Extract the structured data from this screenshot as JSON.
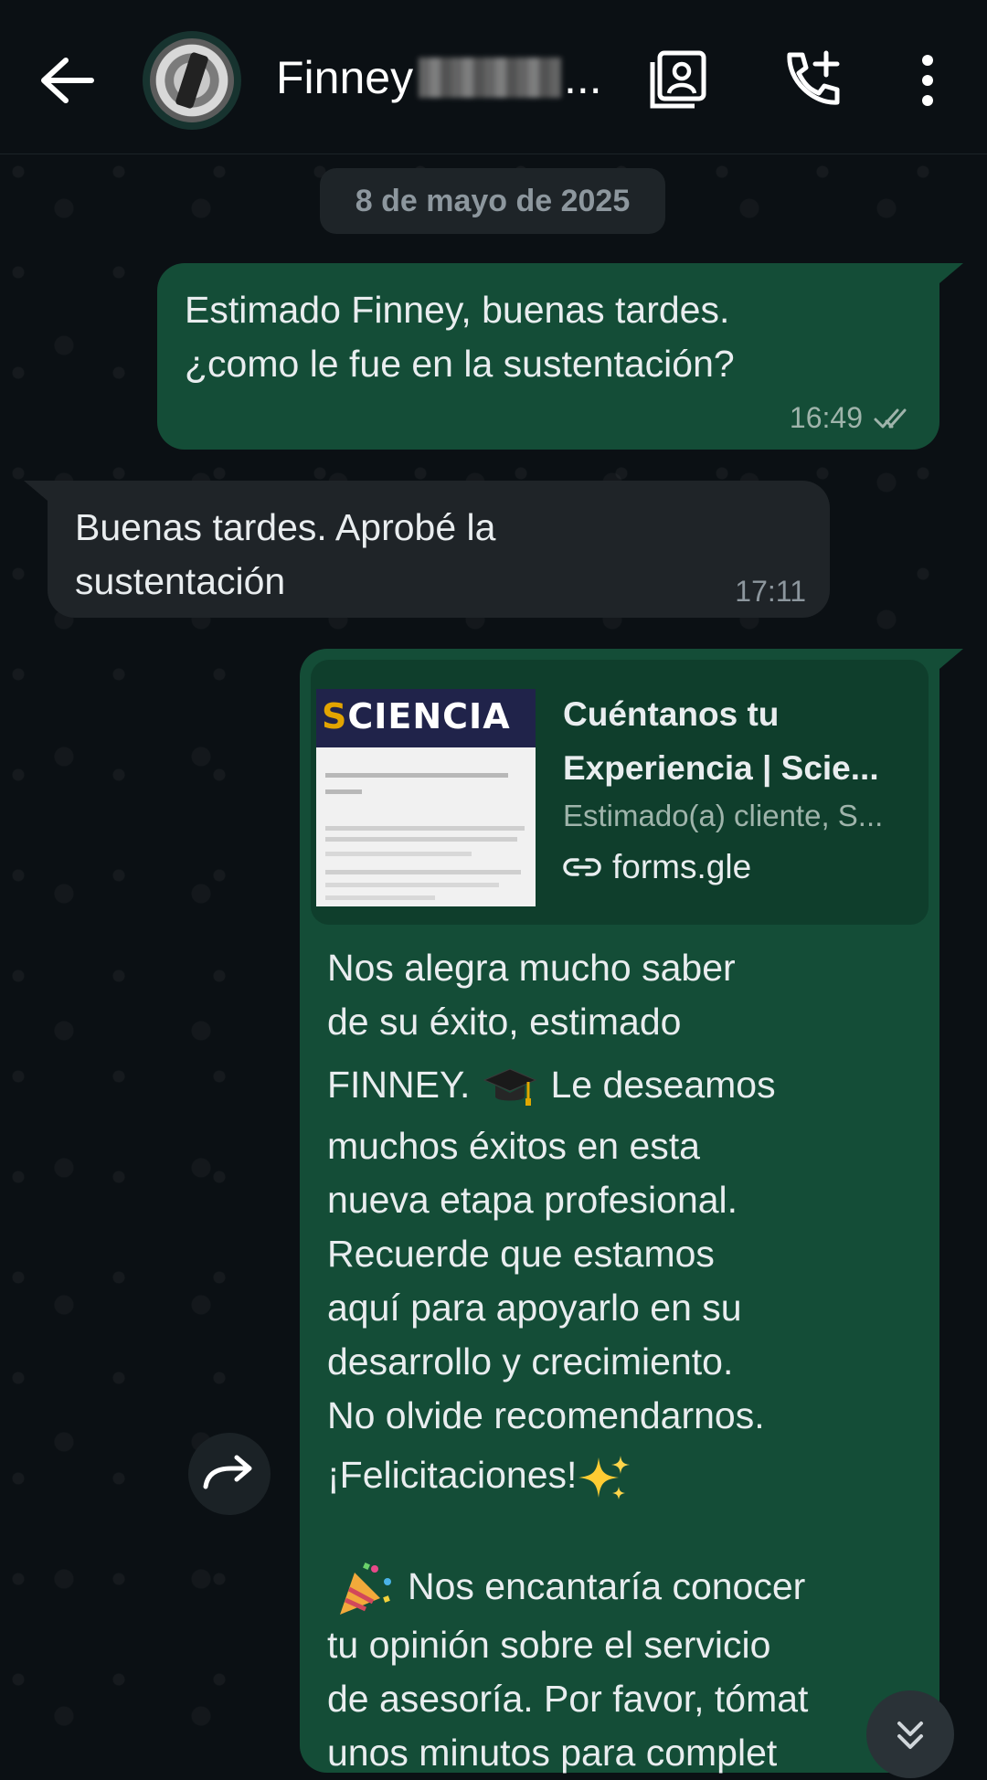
{
  "header": {
    "contact_name": "Finney",
    "name_ellipsis": "..."
  },
  "chat": {
    "date_chip": "8 de mayo de 2025",
    "messages": [
      {
        "direction": "out",
        "lines": [
          "Estimado Finney, buenas tardes.",
          "¿como le fue en la sustentación?"
        ],
        "time": "16:49",
        "status_icon": "double-check-icon"
      },
      {
        "direction": "in",
        "lines": [
          "Buenas tardes. Aprobé la",
          "sustentación"
        ],
        "time": "17:11"
      },
      {
        "direction": "out",
        "link_preview": {
          "thumbnail_logo": "SCIENCIA",
          "title_line1": "Cuéntanos tu",
          "title_line2": "Experiencia | Scie...",
          "description": "Estimado(a) cliente, S...",
          "domain": "forms.gle"
        },
        "lines": [
          "Nos alegra mucho saber",
          "de su éxito, estimado",
          "FINNEY.",
          "Le deseamos",
          "muchos éxitos en esta",
          "nueva etapa profesional.",
          "Recuerde que estamos",
          "aquí para apoyarlo en su",
          "desarrollo y crecimiento.",
          "No olvide recomendarnos.",
          "¡Felicitaciones!",
          "Nos encantaría conocer",
          "tu opinión sobre el servicio",
          "de asesoría. Por favor, tómat",
          "unos minutos para complet"
        ]
      }
    ]
  },
  "colors": {
    "background": "#0b1014",
    "outgoing_bubble": "#144d37",
    "incoming_bubble": "#1f2428",
    "date_chip": "#1e2428"
  }
}
